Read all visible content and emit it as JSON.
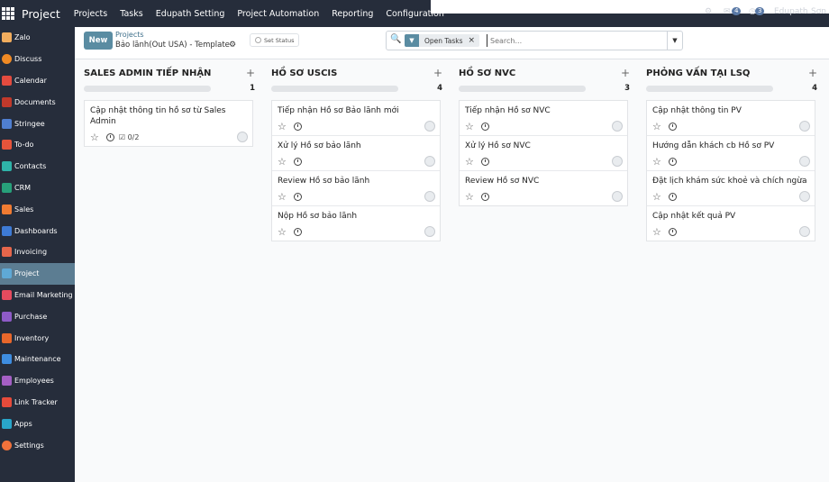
{
  "topbar": {
    "app_name": "Project",
    "menu": [
      "Projects",
      "Tasks",
      "Edupath Setting",
      "Project Automation",
      "Reporting",
      "Configuration"
    ],
    "chat_badge": "4",
    "activity_badge": "3",
    "company": "Edupath",
    "user": "Sơn"
  },
  "sidebar": {
    "items": [
      {
        "label": "Zalo",
        "color": "#f1ad5e"
      },
      {
        "label": "Discuss",
        "color": "#f08a24"
      },
      {
        "label": "Calendar",
        "color": "#e34b3f"
      },
      {
        "label": "Documents",
        "color": "#c0392b"
      },
      {
        "label": "Stringee",
        "color": "#4f7fd1"
      },
      {
        "label": "To-do",
        "color": "#e6543b"
      },
      {
        "label": "Contacts",
        "color": "#2fb3a9"
      },
      {
        "label": "CRM",
        "color": "#27a07a"
      },
      {
        "label": "Sales",
        "color": "#f07b32"
      },
      {
        "label": "Dashboards",
        "color": "#3e7bd6"
      },
      {
        "label": "Invoicing",
        "color": "#e6664b"
      },
      {
        "label": "Project",
        "color": "#5fa9d6"
      },
      {
        "label": "Email Marketing",
        "color": "#e64b5e"
      },
      {
        "label": "Purchase",
        "color": "#8e5bc7"
      },
      {
        "label": "Inventory",
        "color": "#e8672b"
      },
      {
        "label": "Maintenance",
        "color": "#3e8de0"
      },
      {
        "label": "Employees",
        "color": "#a45fc4"
      },
      {
        "label": "Link Tracker",
        "color": "#e64b3b"
      },
      {
        "label": "Apps",
        "color": "#29a5c9"
      },
      {
        "label": "Settings",
        "color": "#f0713b"
      }
    ],
    "active": "Project"
  },
  "control": {
    "new_label": "New",
    "breadcrumb_parent": "Projects",
    "breadcrumb_current": "Bảo lãnh(Out USA) - Template",
    "set_status": "Set Status",
    "facet_label": "Open Tasks",
    "search_placeholder": "Search..."
  },
  "columns": [
    {
      "title": "SALES ADMIN TIẾP NHẬN",
      "count": "1",
      "cards": [
        {
          "title": "Cập nhật thông tin hồ sơ từ Sales Admin",
          "checklist": "0/2"
        }
      ]
    },
    {
      "title": "HỒ SƠ USCIS",
      "count": "4",
      "cards": [
        {
          "title": "Tiếp nhận Hồ sơ Bảo lãnh mới"
        },
        {
          "title": "Xử lý Hồ sơ bảo lãnh"
        },
        {
          "title": "Review Hồ sơ bảo lãnh"
        },
        {
          "title": "Nộp Hồ sơ bảo lãnh"
        }
      ]
    },
    {
      "title": "HỒ SƠ NVC",
      "count": "3",
      "cards": [
        {
          "title": "Tiếp nhận Hồ sơ NVC"
        },
        {
          "title": "Xử lý Hồ sơ NVC"
        },
        {
          "title": "Review Hồ sơ NVC"
        }
      ]
    },
    {
      "title": "PHỎNG VẤN TẠI LSQ",
      "count": "4",
      "cards": [
        {
          "title": "Cập nhật thông tin PV"
        },
        {
          "title": "Hướng dẫn khách cb Hồ sơ PV"
        },
        {
          "title": "Đặt lịch khám sức khoẻ và chích ngừa"
        },
        {
          "title": "Cập nhật kết quả PV"
        }
      ]
    }
  ]
}
